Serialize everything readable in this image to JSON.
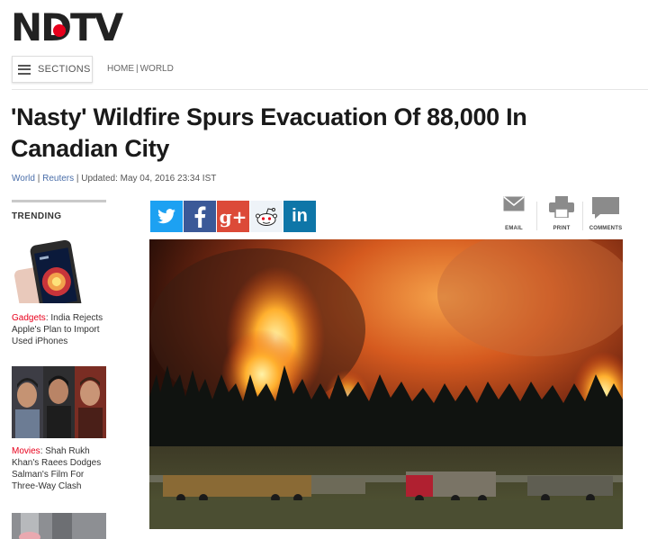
{
  "brand": {
    "logo_text": "NDTV",
    "accent": "#e8001c"
  },
  "nav": {
    "sections_label": "SECTIONS",
    "breadcrumb": [
      "HOME",
      "WORLD"
    ],
    "breadcrumb_sep": "|"
  },
  "article": {
    "headline": "'Nasty' Wildfire Spurs Evacuation Of 88,000 In Canadian City",
    "byline": {
      "category": "World",
      "source": "Reuters",
      "updated": "Updated: May 04, 2016 23:34 IST"
    }
  },
  "sidebar": {
    "trending_title": "TRENDING",
    "items": [
      {
        "category": "Gadgets",
        "text": "India Rejects Apple's Plan to Import Used iPhones"
      },
      {
        "category": "Movies",
        "text": "Shah Rukh Khan's Raees Dodges Salman's Film For Three-Way Clash"
      }
    ]
  },
  "share": {
    "twitter_icon": "twitter-icon",
    "facebook_icon": "facebook-icon",
    "gplus_label": "g+",
    "reddit_icon": "reddit-icon",
    "linkedin_label": "in",
    "colors": {
      "twitter": "#1da1f2",
      "facebook": "#3b5998",
      "gplus": "#dc4a38",
      "linkedin": "#0e76a8"
    }
  },
  "tools": {
    "email_label": "EMAIL",
    "print_label": "PRINT",
    "comments_label": "COMMENTS"
  }
}
